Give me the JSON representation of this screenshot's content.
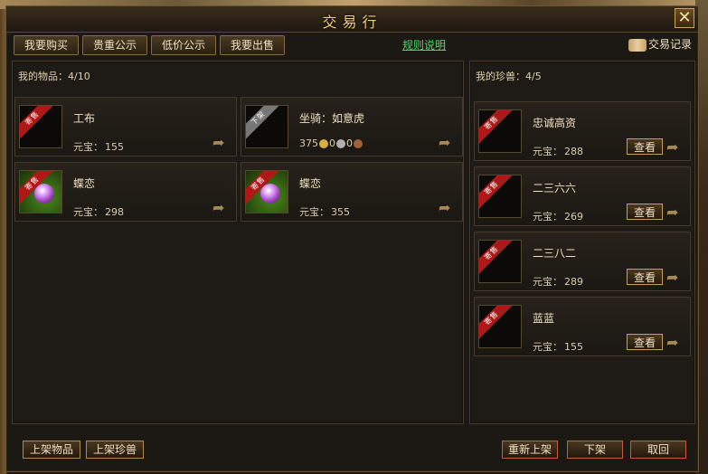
{
  "window": {
    "title": "交易行",
    "close_icon": "close-icon"
  },
  "tabs": [
    {
      "label": "我要购买"
    },
    {
      "label": "贵重公示"
    },
    {
      "label": "低价公示"
    },
    {
      "label": "我要出售"
    }
  ],
  "rules_link": "规则说明",
  "records_label": "交易记录",
  "my_items": {
    "title": "我的物品：4/10",
    "items": [
      {
        "ribbon": "寄售",
        "ribbon_color": "#b01818",
        "name": "工布",
        "price_label": "元宝：",
        "price": "155",
        "icon": "empty-slot"
      },
      {
        "ribbon": "下架",
        "ribbon_color": "#777777",
        "name": "坐骑：如意虎",
        "coin1": "375",
        "coin2": "0",
        "coin3": "0",
        "icon": "empty-slot"
      },
      {
        "ribbon": "寄售",
        "ribbon_color": "#b01818",
        "name": "蝶恋",
        "price_label": "元宝：",
        "price": "298",
        "icon": "gem-icon"
      },
      {
        "ribbon": "寄售",
        "ribbon_color": "#b01818",
        "name": "蝶恋",
        "price_label": "元宝：",
        "price": "355",
        "icon": "gem-icon"
      }
    ]
  },
  "my_pets": {
    "title": "我的珍兽：4/5",
    "view_label": "查看",
    "items": [
      {
        "ribbon": "寄售",
        "name": "忠诚高资",
        "price_label": "元宝：",
        "price": "288"
      },
      {
        "ribbon": "寄售",
        "name": "二三六六",
        "price_label": "元宝：",
        "price": "269"
      },
      {
        "ribbon": "寄售",
        "name": "二三八二",
        "price_label": "元宝：",
        "price": "289"
      },
      {
        "ribbon": "寄售",
        "name": "蓝蓝",
        "price_label": "元宝：",
        "price": "155"
      }
    ]
  },
  "bottom": {
    "list_item": "上架物品",
    "list_pet": "上架珍兽",
    "relist": "重新上架",
    "delist": "下架",
    "cancel": "取回"
  },
  "colors": {
    "accent": "#f0cf7a",
    "link": "#3fe06a",
    "ribbon_red": "#b01818",
    "ribbon_gray": "#777777"
  }
}
